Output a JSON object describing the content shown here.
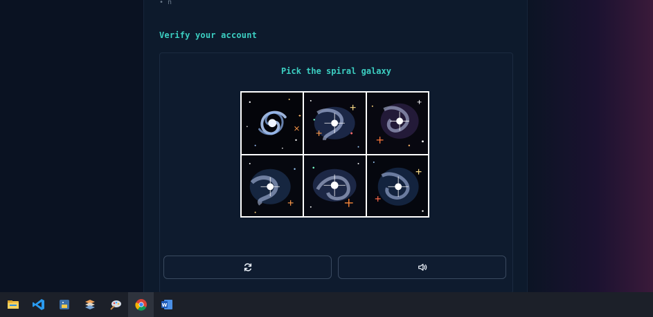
{
  "top_sliver": {
    "text": "• n"
  },
  "verify": {
    "title": "Verify your account"
  },
  "captcha": {
    "prompt": "Pick the spiral galaxy",
    "tiles": [
      {
        "name": "spiral galaxy",
        "kind": "spiral"
      },
      {
        "name": "star cluster",
        "kind": "cluster"
      },
      {
        "name": "star cluster",
        "kind": "cluster"
      },
      {
        "name": "star cluster",
        "kind": "cluster"
      },
      {
        "name": "star cluster",
        "kind": "cluster"
      },
      {
        "name": "star cluster",
        "kind": "cluster"
      }
    ],
    "refresh_icon": "refresh-icon",
    "audio_icon": "speaker-icon"
  },
  "taskbar": {
    "apps": [
      {
        "icon": "file-explorer-icon",
        "active": false
      },
      {
        "icon": "vscode-icon",
        "active": false
      },
      {
        "icon": "python-icon",
        "active": false
      },
      {
        "icon": "stack-icon",
        "active": false
      },
      {
        "icon": "paint-icon",
        "active": false
      },
      {
        "icon": "chrome-icon",
        "active": true
      },
      {
        "icon": "word-icon",
        "active": false
      }
    ]
  },
  "colors": {
    "accent": "#3ccfc2",
    "panel": "#0d1a2c",
    "taskbar": "#1c2029"
  }
}
